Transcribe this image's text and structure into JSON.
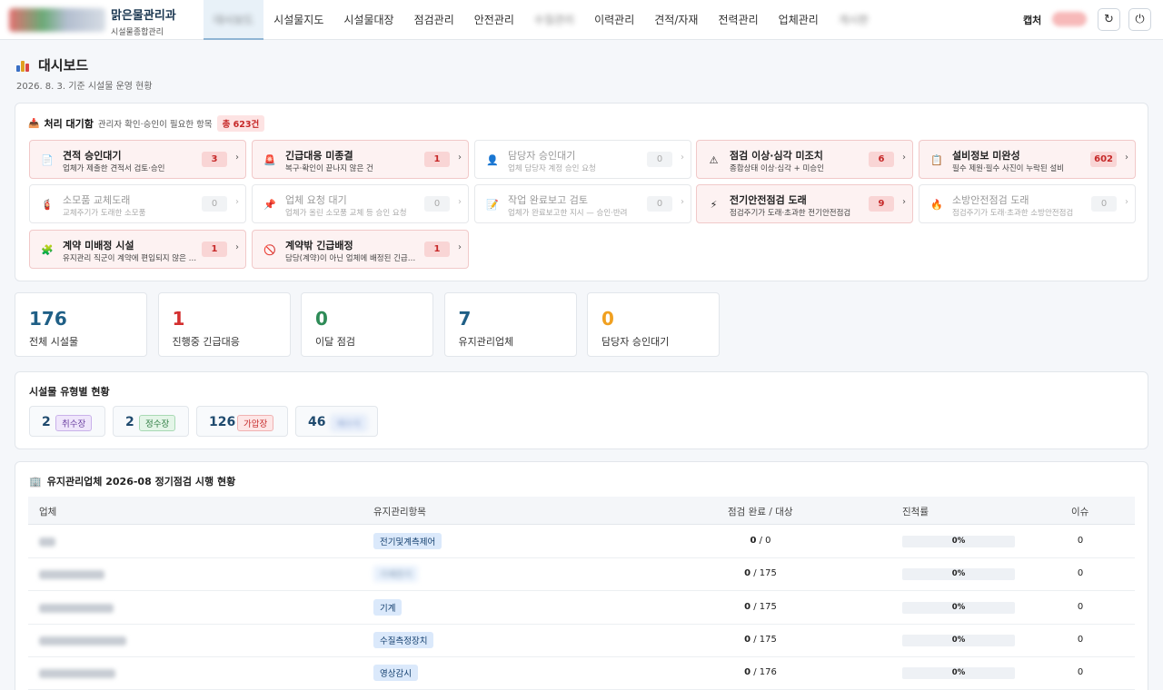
{
  "brand": {
    "title": "맑은물관리과",
    "subtitle": "시설물종합관리"
  },
  "nav": {
    "items": [
      {
        "label": "대시보드",
        "blurred": true
      },
      {
        "label": "시설물지도"
      },
      {
        "label": "시설물대장"
      },
      {
        "label": "점검관리"
      },
      {
        "label": "안전관리"
      },
      {
        "label": "수질관리",
        "blurred": true
      },
      {
        "label": "이력관리"
      },
      {
        "label": "견적/자재"
      },
      {
        "label": "전력관리"
      },
      {
        "label": "업체관리"
      },
      {
        "label": "게시판",
        "blurred": true
      }
    ],
    "capture_label": "캡처",
    "refresh_icon": "↻",
    "power_icon": "⏻"
  },
  "header": {
    "title": "대시보드",
    "subtitle": "2026. 8. 3. 기준 시설물 운영 현황"
  },
  "pending": {
    "title": "처리 대기함",
    "desc": "관리자 확인·승인이 필요한 항목",
    "total": "총 623건",
    "cards": [
      {
        "icon": "document-icon",
        "glyph": "📄",
        "title": "견적 승인대기",
        "desc": "업체가 제출한 견적서 검토·승인",
        "count": "3",
        "state": "alert"
      },
      {
        "icon": "siren-icon",
        "glyph": "🚨",
        "title": "긴급대응 미종결",
        "desc": "복구·확인이 끝나지 않은 건",
        "count": "1",
        "state": "alert"
      },
      {
        "icon": "user-icon",
        "glyph": "👤",
        "title": "담당자 승인대기",
        "desc": "업체 담당자 계정 승인 요청",
        "count": "0",
        "state": "muted"
      },
      {
        "icon": "warning-icon",
        "glyph": "⚠",
        "title": "점검 이상·심각 미조치",
        "desc": "종합상태 이상·심각 + 미승인",
        "count": "6",
        "state": "alert"
      },
      {
        "icon": "clipboard-icon",
        "glyph": "📋",
        "title": "설비정보 미완성",
        "desc": "필수 제원·필수 사진이 누락된 설비",
        "count": "602",
        "state": "alert"
      },
      {
        "icon": "battery-icon",
        "glyph": "🧯",
        "title": "소모품 교체도래",
        "desc": "교체주기가 도래한 소모품",
        "count": "0",
        "state": "muted"
      },
      {
        "icon": "pin-icon",
        "glyph": "📌",
        "title": "업체 요청 대기",
        "desc": "업체가 올린 소모품 교체 등 승인 요청",
        "count": "0",
        "state": "muted"
      },
      {
        "icon": "memo-icon",
        "glyph": "📝",
        "title": "작업 완료보고 검토",
        "desc": "업체가 완료보고한 지시 — 승인·반려",
        "count": "0",
        "state": "muted"
      },
      {
        "icon": "lightning-icon",
        "glyph": "⚡",
        "title": "전기안전점검 도래",
        "desc": "점검주기가 도래·초과한 전기안전점검",
        "count": "9",
        "state": "alert"
      },
      {
        "icon": "fire-icon",
        "glyph": "🔥",
        "title": "소방안전점검 도래",
        "desc": "점검주기가 도래·초과한 소방안전점검",
        "count": "0",
        "state": "muted"
      },
      {
        "icon": "puzzle-icon",
        "glyph": "🧩",
        "title": "계약 미배정 시설",
        "desc": "유지관리 직군이 계약에 편입되지 않은 시설",
        "count": "1",
        "state": "alert"
      },
      {
        "icon": "prohibited-icon",
        "glyph": "🚫",
        "title": "계약밖 긴급배정",
        "desc": "담당(계약)이 아닌 업체에 배정된 긴급대응",
        "count": "1",
        "state": "alert"
      }
    ]
  },
  "stats": [
    {
      "value": "176",
      "label": "전체 시설물",
      "color": "#1f5f86"
    },
    {
      "value": "1",
      "label": "진행중 긴급대응",
      "color": "#d32f2f"
    },
    {
      "value": "0",
      "label": "이달 점검",
      "color": "#2e8b57"
    },
    {
      "value": "7",
      "label": "유지관리업체",
      "color": "#1f5f86"
    },
    {
      "value": "0",
      "label": "담당자 승인대기",
      "color": "#f0a020"
    }
  ],
  "types": {
    "title": "시설물 유형별 현황",
    "items": [
      {
        "count": "2",
        "label": "취수장",
        "bg": "#efe6fb",
        "fg": "#6a3fa0",
        "border": "#c9b2ea"
      },
      {
        "count": "2",
        "label": "정수장",
        "bg": "#e4f5e8",
        "fg": "#2e7d42",
        "border": "#a8d9b4"
      },
      {
        "count": "126",
        "label": "가압장",
        "bg": "#fde6e6",
        "fg": "#c62828",
        "border": "#f0b2b2"
      },
      {
        "count": "46",
        "label": "배수지",
        "bg": "#dfe9fb",
        "fg": "#2a56a8",
        "border": "#b7cbef",
        "blurred": true
      }
    ]
  },
  "maintenance": {
    "title": "유지관리업체 2026-08 정기점검 시행 현황",
    "columns": [
      "업체",
      "유지관리항목",
      "점검 완료 / 대상",
      "진척률",
      "이슈"
    ],
    "rows": [
      {
        "vendor": "업체명",
        "item": "전기및계측제어",
        "done": "0",
        "target": "0",
        "progress": "0%",
        "issue": "0"
      },
      {
        "vendor": "업체명",
        "item": "기계전기",
        "item_blurred": true,
        "done": "0",
        "target": "175",
        "progress": "0%",
        "issue": "0"
      },
      {
        "vendor": "업체명",
        "item": "기계",
        "done": "0",
        "target": "175",
        "progress": "0%",
        "issue": "0"
      },
      {
        "vendor": "업체명",
        "item": "수질측정장치",
        "done": "0",
        "target": "175",
        "progress": "0%",
        "issue": "0"
      },
      {
        "vendor": "업체명",
        "item": "영상감시",
        "done": "0",
        "target": "176",
        "progress": "0%",
        "issue": "0"
      }
    ]
  }
}
